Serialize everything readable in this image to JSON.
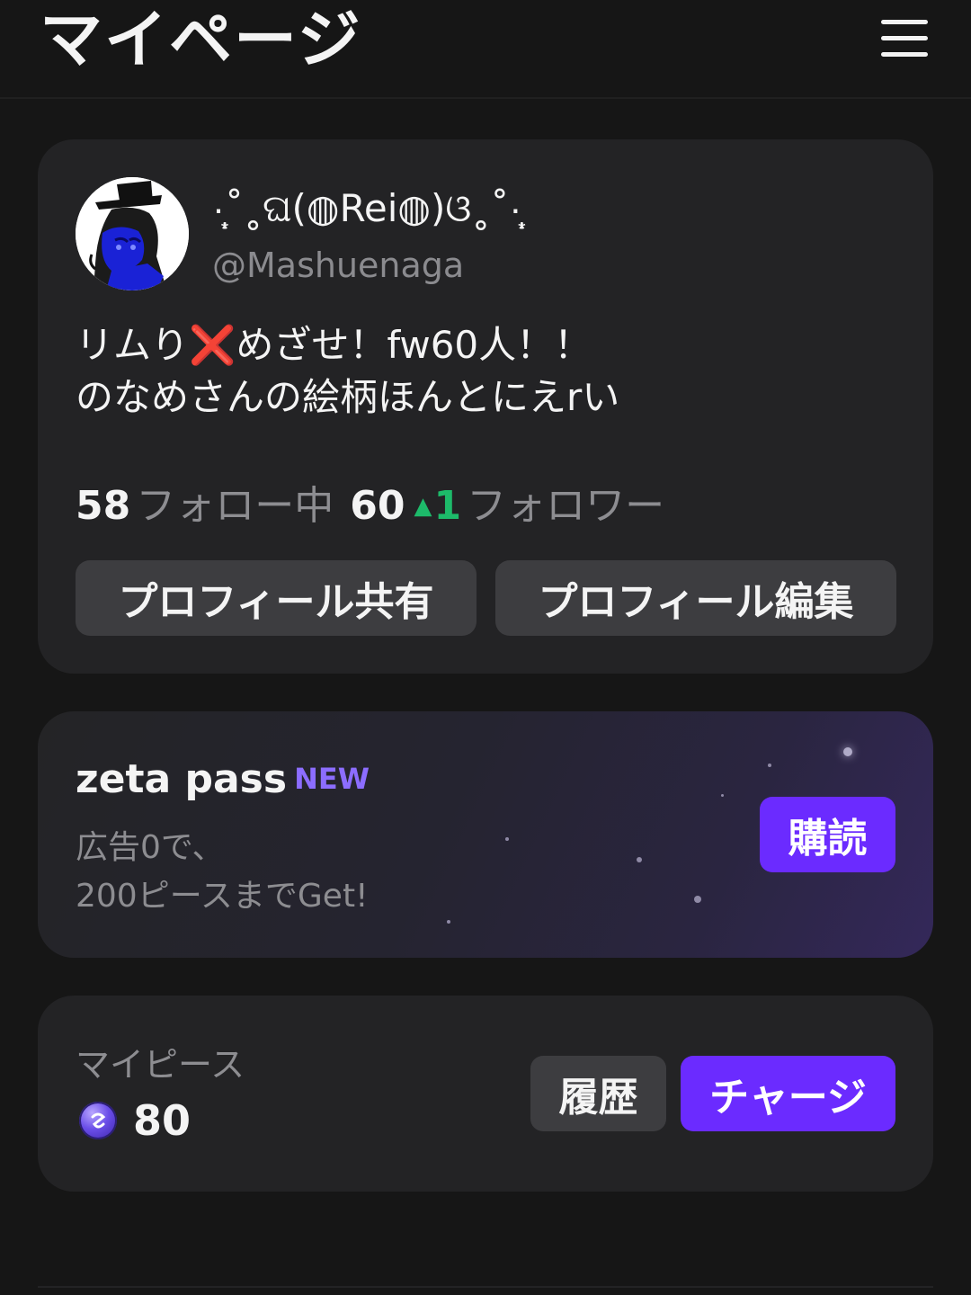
{
  "header": {
    "title": "マイページ",
    "menu_icon": "hamburger-menu-icon"
  },
  "profile": {
    "display_name": "·̩͙˚˳ଘ(◍Rei◍)ଓ˳˚·̩͙",
    "handle": "@Mashuenaga",
    "bio_line1_a": "リムり",
    "bio_line1_x": "❌",
    "bio_line1_b": "めざせ！fw60人！！",
    "bio_line2": "のなめさんの絵柄ほんとにえrい",
    "following_count": "58",
    "following_label": "フォロー中",
    "followers_count": "60",
    "followers_delta_icon": "▲",
    "followers_delta": "1",
    "followers_label": "フォロワー",
    "share_label": "プロフィール共有",
    "edit_label": "プロフィール編集"
  },
  "pass": {
    "title": "zeta pass",
    "badge": "NEW",
    "desc_line1": "広告0で、",
    "desc_line2": "200ピースまでGet!",
    "subscribe_label": "購読"
  },
  "pieces": {
    "label": "マイピース",
    "count": "80",
    "coin_icon": "coin-icon",
    "history_label": "履歴",
    "charge_label": "チャージ"
  },
  "colors": {
    "background": "#161616",
    "card": "#232325",
    "accent_purple": "#6b2bff",
    "new_badge": "#8c6dff",
    "positive_green": "#1dba6a",
    "x_red": "#e8231d"
  }
}
